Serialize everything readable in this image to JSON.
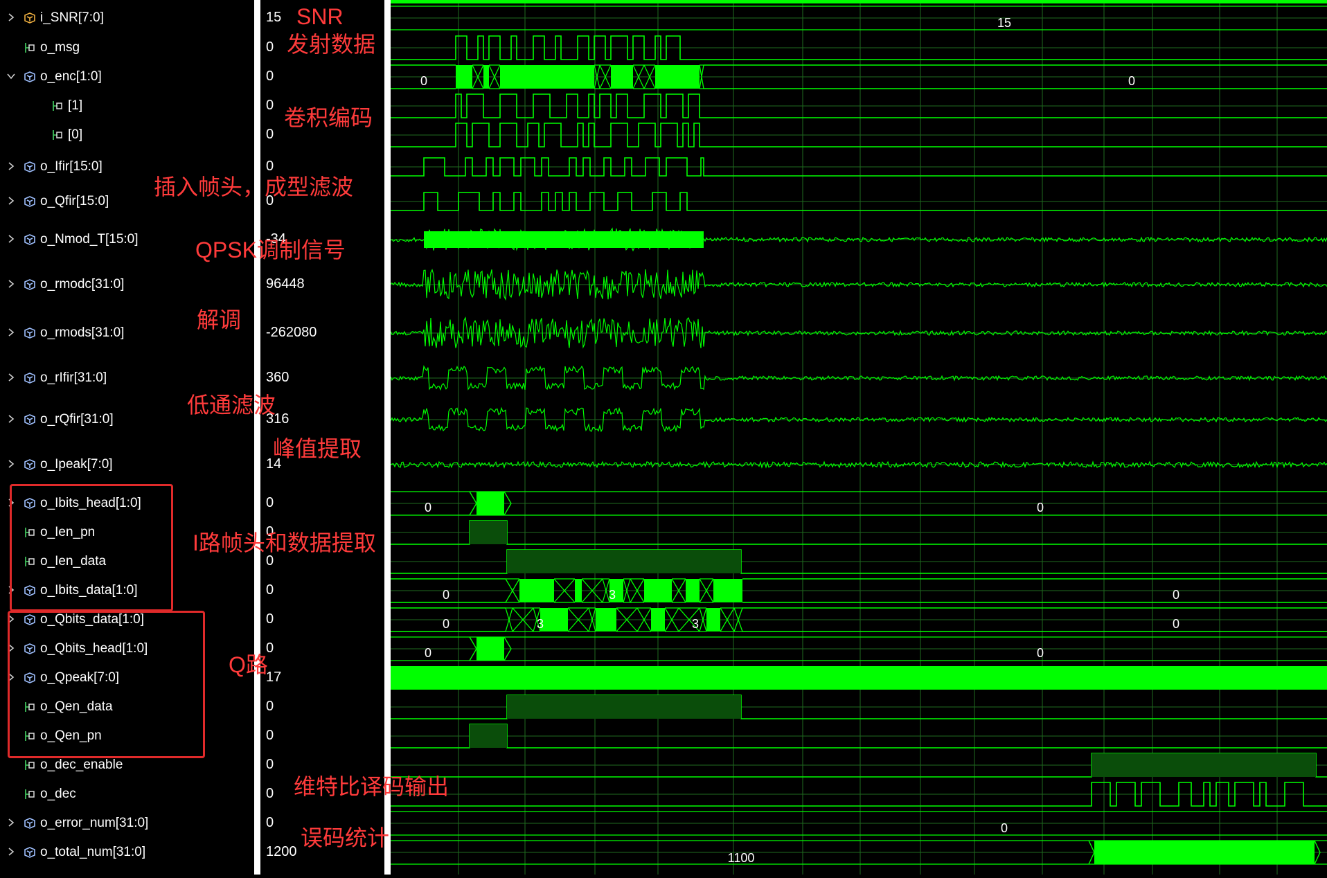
{
  "signals": [
    {
      "name": "i_SNR[7:0]",
      "value": "15",
      "kind": "bus",
      "expand": ">",
      "icon": "bus-in-icon"
    },
    {
      "name": "o_msg",
      "value": "0",
      "kind": "bit",
      "expand": "",
      "icon": "bit-icon"
    },
    {
      "name": "o_enc[1:0]",
      "value": "0",
      "kind": "bus",
      "expand": "v",
      "icon": "bus-icon"
    },
    {
      "name": "[1]",
      "value": "0",
      "kind": "bit",
      "expand": "",
      "icon": "bit-icon",
      "indent": true
    },
    {
      "name": "[0]",
      "value": "0",
      "kind": "bit",
      "expand": "",
      "icon": "bit-icon",
      "indent": true
    },
    {
      "name": "o_Ifir[15:0]",
      "value": "0",
      "kind": "bus",
      "expand": ">",
      "icon": "bus-icon"
    },
    {
      "name": "o_Qfir[15:0]",
      "value": "0",
      "kind": "bus",
      "expand": ">",
      "icon": "bus-icon"
    },
    {
      "name": "o_Nmod_T[15:0]",
      "value": "-34",
      "kind": "bus",
      "expand": ">",
      "icon": "bus-icon"
    },
    {
      "name": "o_rmodc[31:0]",
      "value": "96448",
      "kind": "bus",
      "expand": ">",
      "icon": "bus-icon"
    },
    {
      "name": "o_rmods[31:0]",
      "value": "-262080",
      "kind": "bus",
      "expand": ">",
      "icon": "bus-icon"
    },
    {
      "name": "o_rIfir[31:0]",
      "value": "360",
      "kind": "bus",
      "expand": ">",
      "icon": "bus-icon"
    },
    {
      "name": "o_rQfir[31:0]",
      "value": "316",
      "kind": "bus",
      "expand": ">",
      "icon": "bus-icon"
    },
    {
      "name": "o_Ipeak[7:0]",
      "value": "14",
      "kind": "bus",
      "expand": ">",
      "icon": "bus-icon"
    },
    {
      "name": "o_Ibits_head[1:0]",
      "value": "0",
      "kind": "bus",
      "expand": ">",
      "icon": "bus-icon"
    },
    {
      "name": "o_Ien_pn",
      "value": "0",
      "kind": "bit",
      "expand": "",
      "icon": "bit-icon"
    },
    {
      "name": "o_Ien_data",
      "value": "0",
      "kind": "bit",
      "expand": "",
      "icon": "bit-icon"
    },
    {
      "name": "o_Ibits_data[1:0]",
      "value": "0",
      "kind": "bus",
      "expand": ">",
      "icon": "bus-icon"
    },
    {
      "name": "o_Qbits_data[1:0]",
      "value": "0",
      "kind": "bus",
      "expand": ">",
      "icon": "bus-icon"
    },
    {
      "name": "o_Qbits_head[1:0]",
      "value": "0",
      "kind": "bus",
      "expand": ">",
      "icon": "bus-icon"
    },
    {
      "name": "o_Qpeak[7:0]",
      "value": "17",
      "kind": "bus",
      "expand": ">",
      "icon": "bus-icon"
    },
    {
      "name": "o_Qen_data",
      "value": "0",
      "kind": "bit",
      "expand": "",
      "icon": "bit-icon"
    },
    {
      "name": "o_Qen_pn",
      "value": "0",
      "kind": "bit",
      "expand": "",
      "icon": "bit-icon"
    },
    {
      "name": "o_dec_enable",
      "value": "0",
      "kind": "bit",
      "expand": "",
      "icon": "bit-icon"
    },
    {
      "name": "o_dec",
      "value": "0",
      "kind": "bit",
      "expand": "",
      "icon": "bit-icon"
    },
    {
      "name": "o_error_num[31:0]",
      "value": "0",
      "kind": "bus",
      "expand": ">",
      "icon": "bus-icon"
    },
    {
      "name": "o_total_num[31:0]",
      "value": "1200",
      "kind": "bus",
      "expand": ">",
      "icon": "bus-icon"
    }
  ],
  "annotations": [
    {
      "text": "SNR"
    },
    {
      "text": "发射数据"
    },
    {
      "text": "卷积编码"
    },
    {
      "text": "插入帧头，成型滤波"
    },
    {
      "text": "QPSK调制信号"
    },
    {
      "text": "解调"
    },
    {
      "text": "低通滤波"
    },
    {
      "text": "峰值提取"
    },
    {
      "text": "I路帧头和数据提取"
    },
    {
      "text": "Q路"
    },
    {
      "text": "维特比译码输出"
    },
    {
      "text": "误码统计"
    }
  ],
  "wave_labels": {
    "snr": "15",
    "enc_left": "0",
    "enc_right": "0",
    "ihead_left": "0",
    "ihead_right": "0",
    "idata_left": "0",
    "idata_mid": "3",
    "idata_right": "0",
    "qdata_left": "0",
    "qdata_mid1": "3",
    "qdata_mid2": "3",
    "qdata_right": "0",
    "qhead_left": "0",
    "qhead_right": "0",
    "error": "0",
    "total": "1100"
  },
  "colors": {
    "wave": "#00ff00",
    "wave_fill": "#0a4d0a",
    "grid": "#1f6b1f",
    "annotation": "#ff3b3b",
    "box": "#e02a2a"
  }
}
